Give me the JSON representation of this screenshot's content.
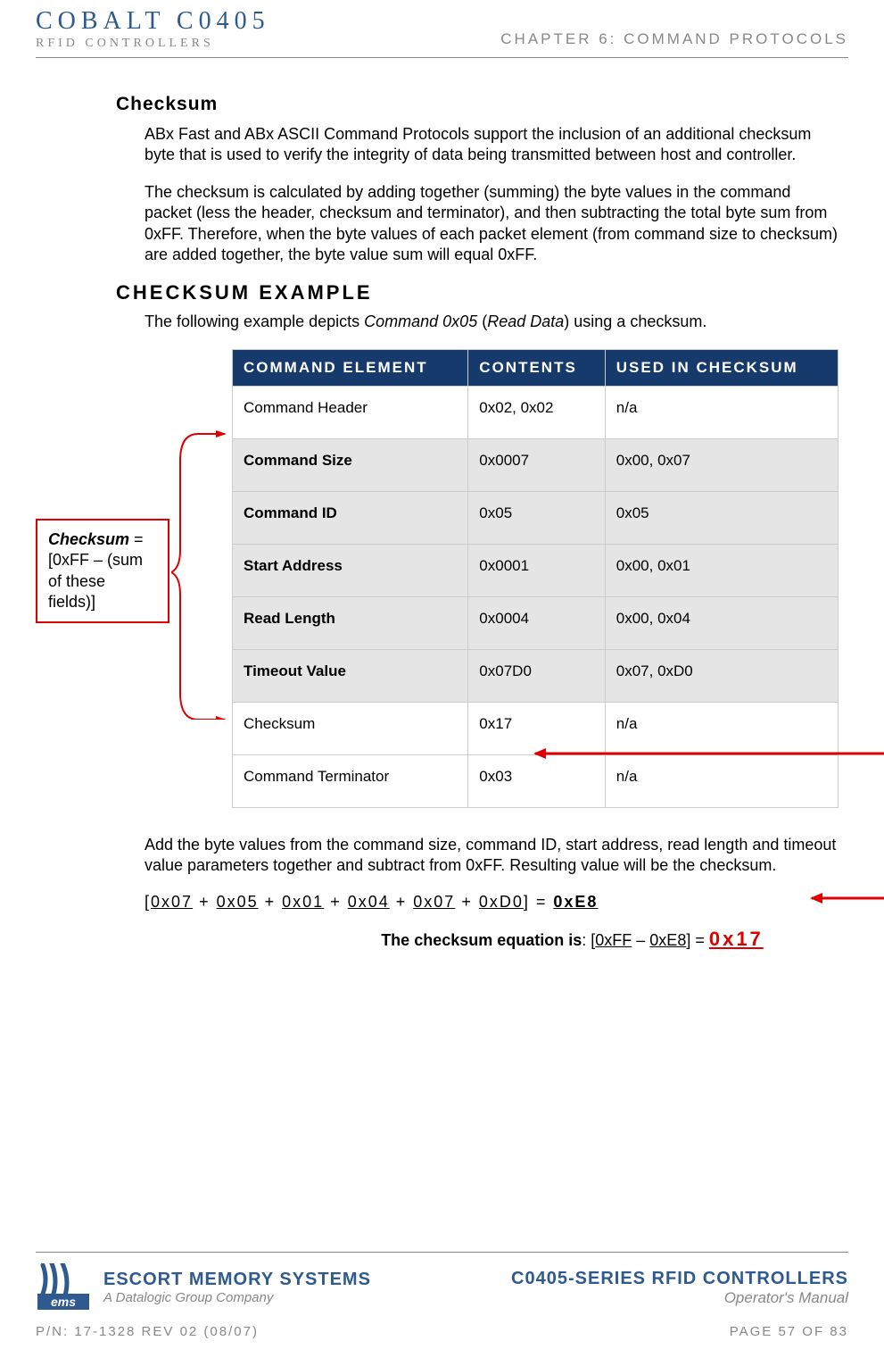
{
  "header": {
    "logo_line1": "COBALT C0405",
    "logo_line2": "RFID CONTROLLERS",
    "chapter": "CHAPTER 6: COMMAND PROTOCOLS"
  },
  "section": {
    "heading": "Checksum",
    "para1": "ABx Fast and ABx ASCII Command Protocols support the inclusion of an additional checksum byte that is used to verify the integrity of data being transmitted between host and controller.",
    "para2": "The checksum is calculated by adding together (summing) the byte values in the command packet (less the header, checksum and terminator), and then subtracting the total byte sum from 0xFF. Therefore, when the byte values of each packet element (from command size to checksum) are added together, the byte value sum will equal 0xFF.",
    "example_heading": "CHECKSUM EXAMPLE",
    "example_intro_pre": "The following example depicts ",
    "example_intro_em": "Command 0x05",
    "example_intro_paren_pre": " (",
    "example_intro_em2": "Read Data",
    "example_intro_post": ") using a checksum."
  },
  "callout": {
    "label_bold": "Checksum",
    "label_rest": " = [0xFF – (sum of these fields)]"
  },
  "table": {
    "headers": [
      "COMMAND ELEMENT",
      "CONTENTS",
      "USED IN CHECKSUM"
    ],
    "rows": [
      {
        "shaded": false,
        "cells": [
          "Command Header",
          "0x02, 0x02",
          "n/a"
        ]
      },
      {
        "shaded": true,
        "cells": [
          "Command Size",
          "0x0007",
          "0x00, 0x07"
        ]
      },
      {
        "shaded": true,
        "cells": [
          "Command ID",
          "0x05",
          "0x05"
        ]
      },
      {
        "shaded": true,
        "cells": [
          "Start Address",
          "0x0001",
          "0x00, 0x01"
        ]
      },
      {
        "shaded": true,
        "cells": [
          "Read Length",
          "0x0004",
          "0x00, 0x04"
        ]
      },
      {
        "shaded": true,
        "cells": [
          "Timeout Value",
          "0x07D0",
          "0x07, 0xD0"
        ]
      },
      {
        "shaded": false,
        "cells": [
          "Checksum",
          "0x17",
          "n/a"
        ]
      },
      {
        "shaded": false,
        "cells": [
          "Command Terminator",
          "0x03",
          "n/a"
        ]
      }
    ]
  },
  "post_table": {
    "para": "Add the byte values from the command size, command ID, start address, read length and timeout value parameters together and subtract from 0xFF. Resulting value will be the checksum.",
    "equation_terms": [
      "0x07",
      "0x05",
      "0x01",
      "0x04",
      "0x07",
      "0xD0"
    ],
    "equation_result": "0xE8",
    "checksum_eq_label": "The checksum equation is",
    "checksum_eq_lhs1": "0xFF",
    "checksum_eq_lhs2": "0xE8",
    "checksum_eq_result": "0x17"
  },
  "footer": {
    "ems_title": "ESCORT MEMORY SYSTEMS",
    "ems_sub": "A Datalogic Group Company",
    "ems_logo_text": "ems",
    "ctrl_title": "C0405-SERIES RFID CONTROLLERS",
    "ctrl_sub": "Operator's Manual",
    "pn": "P/N: 17-1328 REV 02 (08/07)",
    "page": "PAGE 57 OF 83"
  }
}
